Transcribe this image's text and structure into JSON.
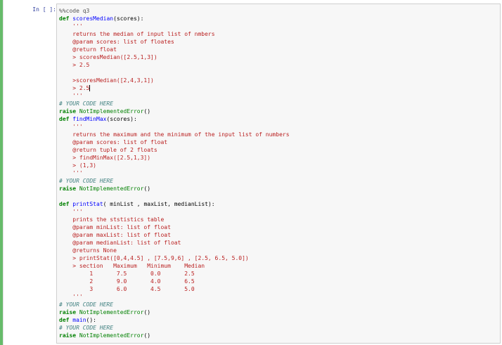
{
  "cell": {
    "prompt": "In [ ]:",
    "lines": [
      [
        {
          "t": "%%code q3",
          "c": "magic"
        }
      ],
      [
        {
          "t": "def",
          "c": "keyword"
        },
        {
          "t": " ",
          "c": "plain"
        },
        {
          "t": "scoresMedian",
          "c": "funcname"
        },
        {
          "t": "(scores):",
          "c": "plain"
        }
      ],
      [
        {
          "t": "    '''",
          "c": "string"
        }
      ],
      [
        {
          "t": "    returns the median of input list of nmbers",
          "c": "string"
        }
      ],
      [
        {
          "t": "    @param scores: list of floates",
          "c": "string"
        }
      ],
      [
        {
          "t": "    @return float",
          "c": "string"
        }
      ],
      [
        {
          "t": "    > scoresMedian([2.5,1,3])",
          "c": "string"
        }
      ],
      [
        {
          "t": "    > 2.5",
          "c": "string"
        }
      ],
      [
        {
          "t": "",
          "c": "plain"
        }
      ],
      [
        {
          "t": "    >scoresMedian([2,4,3,1])",
          "c": "string"
        }
      ],
      [
        {
          "t": "    > 2.5",
          "c": "string"
        },
        {
          "cursor": true
        }
      ],
      [
        {
          "t": "    '''",
          "c": "string"
        }
      ],
      [
        {
          "t": "# YOUR CODE HERE",
          "c": "comment"
        }
      ],
      [
        {
          "t": "raise",
          "c": "keyword"
        },
        {
          "t": " ",
          "c": "plain"
        },
        {
          "t": "NotImplementedError",
          "c": "builtin"
        },
        {
          "t": "()",
          "c": "plain"
        }
      ],
      [
        {
          "t": "def",
          "c": "keyword"
        },
        {
          "t": " ",
          "c": "plain"
        },
        {
          "t": "findMinMax",
          "c": "funcname"
        },
        {
          "t": "(scores):",
          "c": "plain"
        }
      ],
      [
        {
          "t": "    '''",
          "c": "string"
        }
      ],
      [
        {
          "t": "    returns the maximum and the minimum of the input list of numbers",
          "c": "string"
        }
      ],
      [
        {
          "t": "    @param scores: list of float",
          "c": "string"
        }
      ],
      [
        {
          "t": "    @return tuple of 2 floats",
          "c": "string"
        }
      ],
      [
        {
          "t": "    > findMinMax([2.5,1,3])",
          "c": "string"
        }
      ],
      [
        {
          "t": "    > (1,3)",
          "c": "string"
        }
      ],
      [
        {
          "t": "    '''",
          "c": "string"
        }
      ],
      [
        {
          "t": "# YOUR CODE HERE",
          "c": "comment"
        }
      ],
      [
        {
          "t": "raise",
          "c": "keyword"
        },
        {
          "t": " ",
          "c": "plain"
        },
        {
          "t": "NotImplementedError",
          "c": "builtin"
        },
        {
          "t": "()",
          "c": "plain"
        }
      ],
      [
        {
          "t": "",
          "c": "plain"
        }
      ],
      [
        {
          "t": "def",
          "c": "keyword"
        },
        {
          "t": " ",
          "c": "plain"
        },
        {
          "t": "printStat",
          "c": "funcname"
        },
        {
          "t": "( minList , maxList, medianList):",
          "c": "plain"
        }
      ],
      [
        {
          "t": "    '''",
          "c": "string"
        }
      ],
      [
        {
          "t": "    prints the ststistics table",
          "c": "string"
        }
      ],
      [
        {
          "t": "    @param minList: list of float",
          "c": "string"
        }
      ],
      [
        {
          "t": "    @param maxList: list of float",
          "c": "string"
        }
      ],
      [
        {
          "t": "    @param medianList: list of float",
          "c": "string"
        }
      ],
      [
        {
          "t": "    @returns None",
          "c": "string"
        }
      ],
      [
        {
          "t": "    > printStat([0,4,4.5] , [7.5,9,6] , [2.5, 6.5, 5.0])",
          "c": "string"
        }
      ],
      [
        {
          "t": "    > section   Maximum   Minimum    Median",
          "c": "string"
        }
      ],
      [
        {
          "t": "         1       7.5       0.0       2.5",
          "c": "string"
        }
      ],
      [
        {
          "t": "         2       9.0       4.0       6.5",
          "c": "string"
        }
      ],
      [
        {
          "t": "         3       6.0       4.5       5.0",
          "c": "string"
        }
      ],
      [
        {
          "t": "    '''",
          "c": "string"
        }
      ],
      [
        {
          "t": "# YOUR CODE HERE",
          "c": "comment"
        }
      ],
      [
        {
          "t": "raise",
          "c": "keyword"
        },
        {
          "t": " ",
          "c": "plain"
        },
        {
          "t": "NotImplementedError",
          "c": "builtin"
        },
        {
          "t": "()",
          "c": "plain"
        }
      ],
      [
        {
          "t": "def",
          "c": "keyword"
        },
        {
          "t": " ",
          "c": "plain"
        },
        {
          "t": "main",
          "c": "funcname"
        },
        {
          "t": "():",
          "c": "plain"
        }
      ],
      [
        {
          "t": "# YOUR CODE HERE",
          "c": "comment"
        }
      ],
      [
        {
          "t": "raise",
          "c": "keyword"
        },
        {
          "t": " ",
          "c": "plain"
        },
        {
          "t": "NotImplementedError",
          "c": "builtin"
        },
        {
          "t": "()",
          "c": "plain"
        }
      ]
    ]
  }
}
